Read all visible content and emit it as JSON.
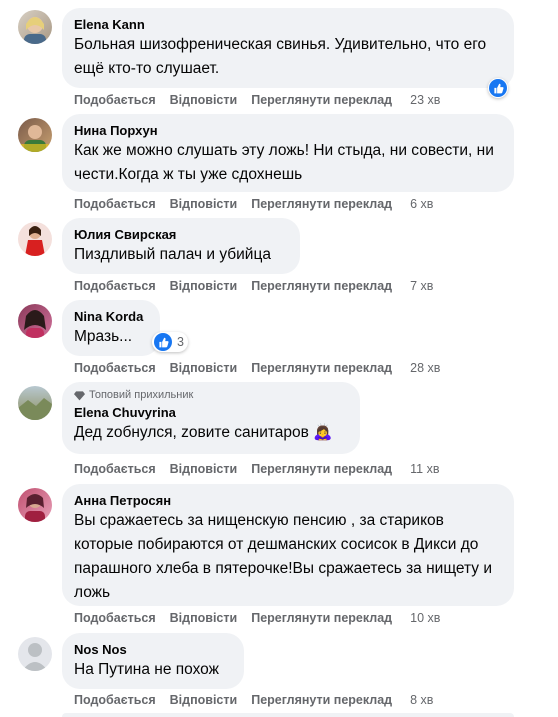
{
  "labels": {
    "like": "Подобається",
    "reply": "Відповісти",
    "translate": "Переглянути переклад"
  },
  "comments": [
    {
      "author": "Elena Kann",
      "text": "Больная шизофреническая свинья. Удивительно, что его ещё кто-то слушает.",
      "time": "23 хв",
      "reactions": ""
    },
    {
      "author": "Нина Порхун",
      "text": "Как же можно слушать эту ложь! Ни стыда, ни совести, ни чести.Когда ж ты уже сдохнешь",
      "time": "6 хв"
    },
    {
      "author": "Юлия Свирская",
      "text": "Пиздливый палач и убийца",
      "time": "7 хв"
    },
    {
      "author": "Nina Korda",
      "text": "Мразь...",
      "time": "28 хв",
      "reactions": "3"
    },
    {
      "author": "Elena Chuvyrina",
      "badge": "Топовий прихильник",
      "text": "Дед zобнулся, zовите санитаров",
      "emoji": "🙇‍♀️",
      "time": "11 хв"
    },
    {
      "author": "Анна Петросян",
      "text": "Вы сражаетесь за нищенскую пенсию , за стариков которые побираются от дешманских сосисок в Дикси до парашного хлеба в пятерочке!Вы сражаетесь за нищету и ложь",
      "time": "10 хв"
    },
    {
      "author": "Nos Nos",
      "text": "На Путина не похож",
      "time": "8 хв"
    }
  ],
  "colors": {
    "accent": "#1877f2",
    "bubble": "#f0f2f5",
    "meta": "#65676b"
  }
}
